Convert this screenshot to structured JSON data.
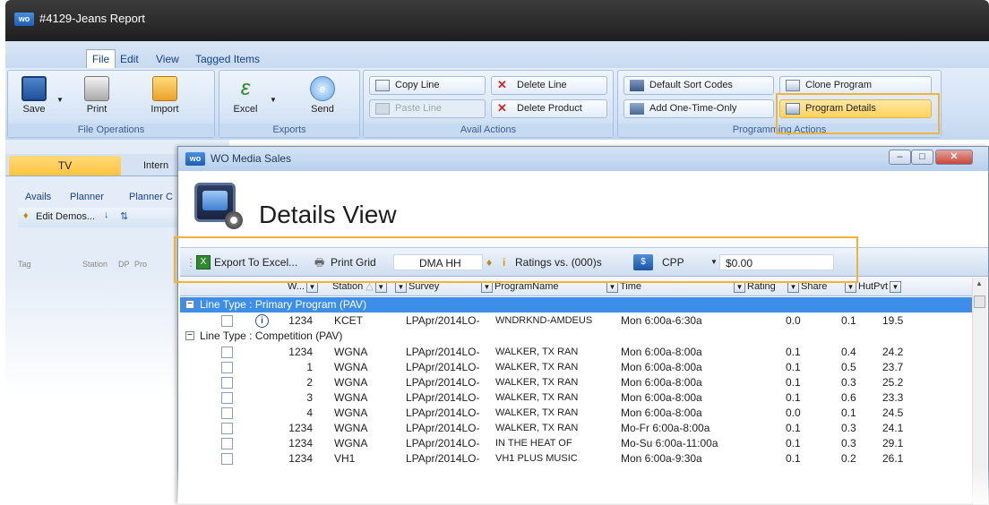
{
  "main_window": {
    "title": "#4129-Jeans Report",
    "logo": "wo"
  },
  "menu": {
    "items": [
      "File",
      "Edit",
      "View",
      "Tagged Items"
    ]
  },
  "ribbon": {
    "groups": [
      {
        "label": "File Operations",
        "buttons": [
          "Save",
          "Print",
          "Import"
        ]
      },
      {
        "label": "Exports",
        "buttons": [
          "Excel",
          "Send"
        ]
      },
      {
        "label": "Avail Actions",
        "buttons": [
          "Copy Line",
          "Paste Line",
          "Delete Line",
          "Delete Product"
        ]
      },
      {
        "label": "Programming Actions",
        "buttons": [
          "Default Sort Codes",
          "Add One-Time-Only",
          "Clone Program",
          "Program Details"
        ]
      }
    ]
  },
  "left_panel": {
    "media_tabs": [
      "TV",
      "Intern"
    ],
    "sub_tabs": [
      "Avails",
      "Planner",
      "Planner C"
    ],
    "edit_demos": "Edit Demos...",
    "header_cols": [
      "Tag",
      "Station",
      "DP",
      "Pro"
    ]
  },
  "dialog": {
    "title": "WO Media Sales",
    "heading": "Details View",
    "toolbar": {
      "export": "Export To Excel...",
      "print": "Print Grid",
      "demo": "DMA HH",
      "ratings": "Ratings vs. (000)s",
      "cost_type": "CPP",
      "cost_value": "$0.00"
    },
    "grid": {
      "columns": [
        "W...",
        "Station",
        "Survey",
        "ProgramName",
        "Time",
        "Rating",
        "Share",
        "HutPvt"
      ],
      "groups": [
        {
          "label": "Line Type : Primary Program (PAV)",
          "rows": [
            {
              "info": true,
              "w": "1234",
              "station": "KCET",
              "survey": "LPApr/2014LO-",
              "program": "WNDRKND-AMDEUS",
              "time": "Mon 6:00a-6:30a",
              "rating": "0.0",
              "share": "0.1",
              "hutpvt": "19.5"
            }
          ]
        },
        {
          "label": "Line Type : Competition (PAV)",
          "rows": [
            {
              "w": "1234",
              "station": "WGNA",
              "survey": "LPApr/2014LO-",
              "program": "WALKER, TX RAN",
              "time": "Mon 6:00a-8:00a",
              "rating": "0.1",
              "share": "0.4",
              "hutpvt": "24.2"
            },
            {
              "w": "1",
              "station": "WGNA",
              "survey": "LPApr/2014LO-",
              "program": "WALKER, TX RAN",
              "time": "Mon 6:00a-8:00a",
              "rating": "0.1",
              "share": "0.5",
              "hutpvt": "23.7"
            },
            {
              "w": "2",
              "station": "WGNA",
              "survey": "LPApr/2014LO-",
              "program": "WALKER, TX RAN",
              "time": "Mon 6:00a-8:00a",
              "rating": "0.1",
              "share": "0.3",
              "hutpvt": "25.2"
            },
            {
              "w": "3",
              "station": "WGNA",
              "survey": "LPApr/2014LO-",
              "program": "WALKER, TX RAN",
              "time": "Mon 6:00a-8:00a",
              "rating": "0.1",
              "share": "0.6",
              "hutpvt": "23.3"
            },
            {
              "w": "4",
              "station": "WGNA",
              "survey": "LPApr/2014LO-",
              "program": "WALKER, TX RAN",
              "time": "Mon 6:00a-8:00a",
              "rating": "0.0",
              "share": "0.1",
              "hutpvt": "24.5"
            },
            {
              "w": "1234",
              "station": "WGNA",
              "survey": "LPApr/2014LO-",
              "program": "WALKER, TX RAN",
              "time": "Mo-Fr 6:00a-8:00a",
              "rating": "0.1",
              "share": "0.3",
              "hutpvt": "24.1"
            },
            {
              "w": "1234",
              "station": "WGNA",
              "survey": "LPApr/2014LO-",
              "program": "IN THE HEAT OF",
              "time": "Mo-Su 6:00a-11:00a",
              "rating": "0.1",
              "share": "0.3",
              "hutpvt": "29.1"
            },
            {
              "w": "1234",
              "station": "VH1",
              "survey": "LPApr/2014LO-",
              "program": "VH1 PLUS MUSIC",
              "time": "Mon 6:00a-9:30a",
              "rating": "0.1",
              "share": "0.2",
              "hutpvt": "26.1"
            }
          ]
        }
      ]
    }
  },
  "colors": {
    "primary_group": "#3d8ee8",
    "highlight": "#f2b33d",
    "selected_tab": "#ffc43e"
  }
}
